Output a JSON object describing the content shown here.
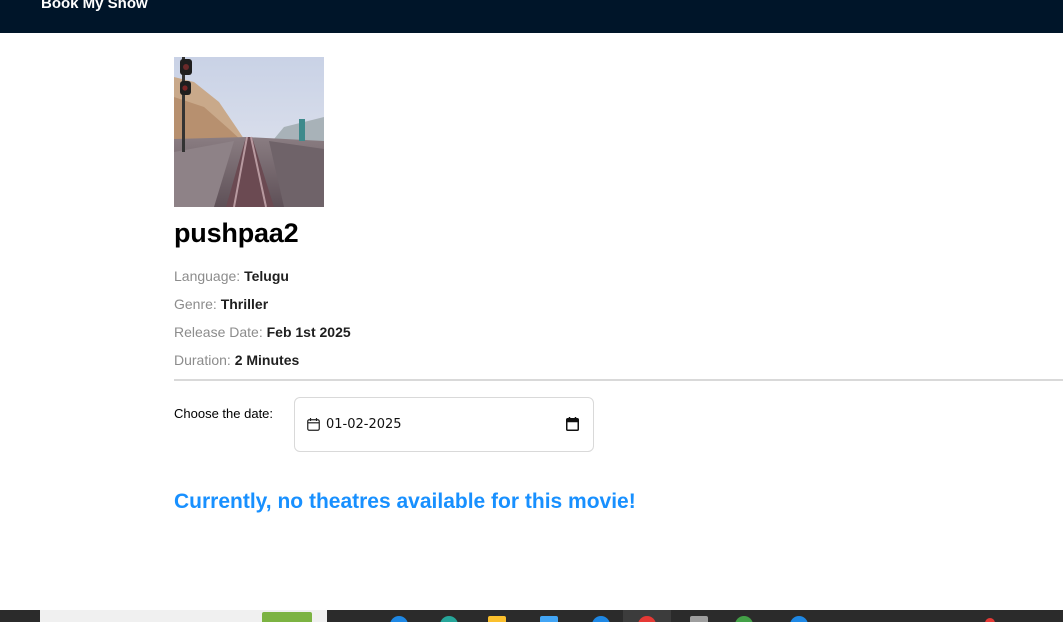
{
  "header": {
    "brand": "Book My Show"
  },
  "movie": {
    "poster_alt": "movie poster",
    "title": "pushpaa2",
    "details": [
      {
        "label": "Language:",
        "value": "Telugu"
      },
      {
        "label": "Genre:",
        "value": "Thriller"
      },
      {
        "label": "Release Date:",
        "value": "Feb 1st 2025"
      },
      {
        "label": "Duration:",
        "value": "2 Minutes"
      }
    ]
  },
  "date_picker": {
    "label": "Choose the date:",
    "value": "01-02-2025",
    "icon": "calendar-icon"
  },
  "message": "Currently, no theatres available for this movie!",
  "colors": {
    "header_bg": "#001529",
    "accent": "#1890ff",
    "muted_label": "#8c8c8c"
  }
}
